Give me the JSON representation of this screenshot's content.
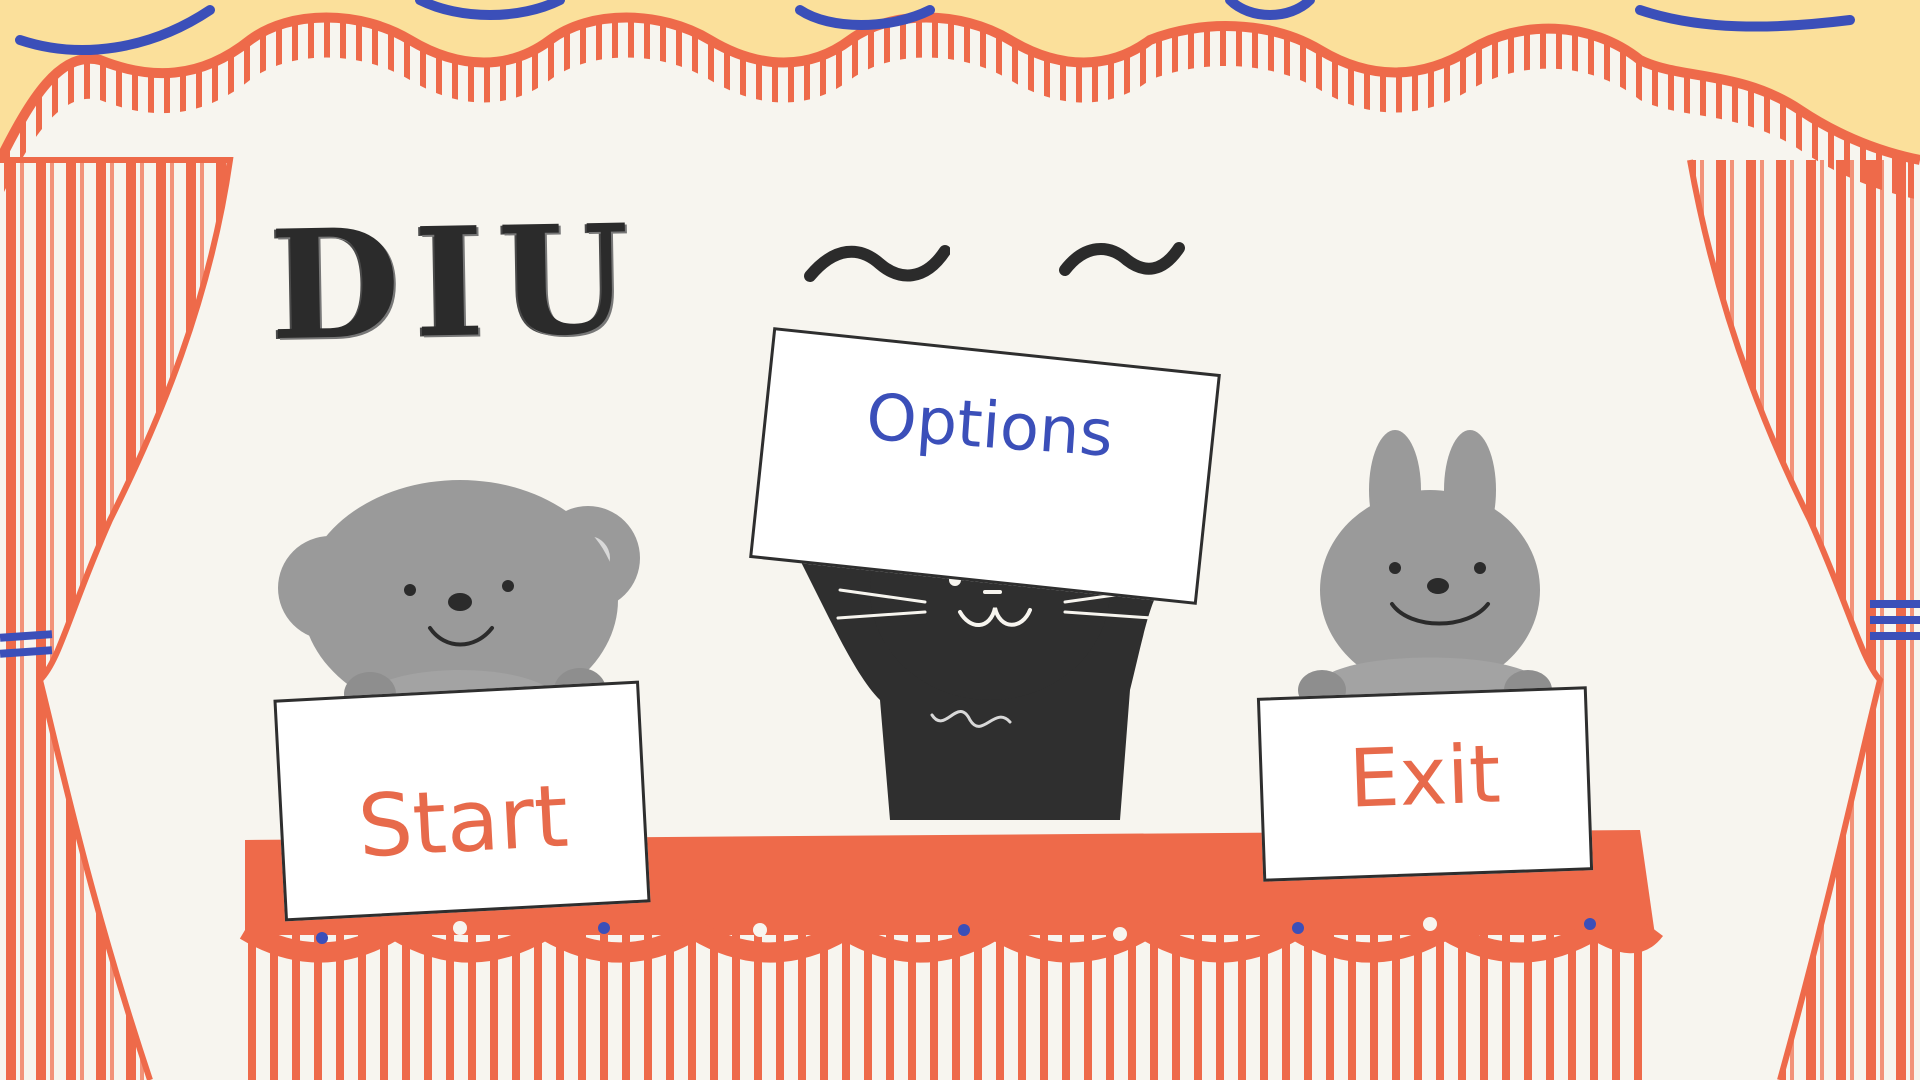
{
  "game": {
    "title": "DIU"
  },
  "menu": {
    "start_label": "Start",
    "options_label": "Options",
    "exit_label": "Exit"
  },
  "colors": {
    "background": "#f7f5ef",
    "curtain_red": "#ee6a4a",
    "valance_yellow": "#fbe09b",
    "accent_blue": "#3b4fb9",
    "animal_gray": "#9a9a9a",
    "cat_black": "#2f2f2f"
  },
  "characters": [
    "monkey-character",
    "cat-character",
    "rabbit-character"
  ]
}
